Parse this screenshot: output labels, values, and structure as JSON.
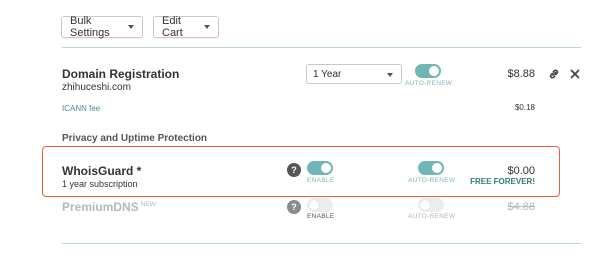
{
  "toolbar": {
    "bulk_settings_label": "Bulk Settings",
    "edit_cart_label": "Edit Cart"
  },
  "domain_item": {
    "title": "Domain Registration",
    "domain": "zhihuceshi.com",
    "period_selected": "1 Year",
    "auto_renew_label": "AUTO-RENEW",
    "auto_renew_on": true,
    "price": "$8.88",
    "icann_fee_label": "ICANN fee",
    "icann_fee_price": "$0.18"
  },
  "section_title": "Privacy and Uptime Protection",
  "whoisguard": {
    "title": "WhoisGuard *",
    "subtitle": "1 year subscription",
    "help": "?",
    "enable_label": "ENABLE",
    "enable_on": true,
    "auto_renew_label": "AUTO-RENEW",
    "auto_renew_on": true,
    "price": "$0.00",
    "free_label": "FREE FOREVER!"
  },
  "premiumdns": {
    "title": "PremiumDNS",
    "badge": "NEW",
    "help": "?",
    "enable_label": "ENABLE",
    "enable_on": false,
    "auto_renew_label": "AUTO-RENEW",
    "auto_renew_on": false,
    "price": "$4.88"
  },
  "colors": {
    "accent": "#6fb7b5",
    "highlight": "#e8603c",
    "free_text": "#2e7d7a"
  },
  "icons": [
    "caret-down-icon",
    "link-icon",
    "close-icon",
    "help-icon"
  ]
}
